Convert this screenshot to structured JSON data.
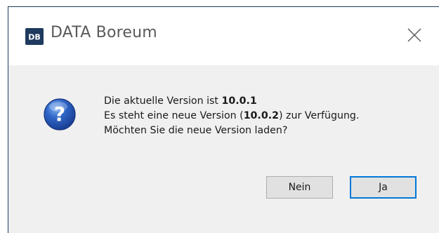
{
  "window": {
    "logo_text": "DB",
    "title": "DATA Boreum",
    "close_icon": "close-icon"
  },
  "message": {
    "icon": "question-icon",
    "line1_prefix": "Die aktuelle Version ist ",
    "current_version": "10.0.1",
    "line2_prefix": "Es steht eine neue Version (",
    "new_version": "10.0.2",
    "line2_suffix": ") zur Verfügung.",
    "line3": "Möchten Sie die neue Version laden?"
  },
  "buttons": {
    "no_label": "Nein",
    "yes_label": "Ja"
  },
  "colors": {
    "title_text": "#5a5a5a",
    "logo_background": "#1f3a5f",
    "default_button_border": "#0078d7",
    "dialog_background": "#f0f0f0"
  }
}
